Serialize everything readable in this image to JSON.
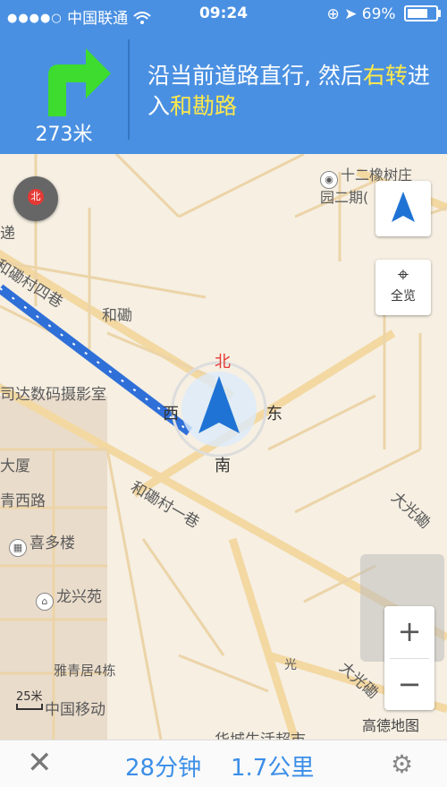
{
  "status_bar": {
    "signal_dots": "●●●●○",
    "carrier": "中国联通",
    "time": "09:24",
    "battery": "69%"
  },
  "guidance": {
    "distance": "273米",
    "instruction_part1": "沿当前道路直行, 然后",
    "instruction_turn": "右转",
    "instruction_part2": "进入",
    "instruction_road": "和勘路"
  },
  "map_labels": {
    "poi_top_right": "十二橡树庄园二期(",
    "road_hechi4": "和磡村四巷",
    "area_hechi": "和磡",
    "studio": "司达数码摄影室",
    "road_hechi1": "和磡村一巷",
    "dasha": "大厦",
    "road_west": "青西路",
    "xiduolou": "喜多楼",
    "longxingyuan": "龙兴苑",
    "yaqingju": "雅青居4栋",
    "china_mobile": "中国移动",
    "supermarket": "华城生活超市",
    "daguang_top": "大光磡",
    "daguang_bottom": "大光磡",
    "edge_ti": "递",
    "bus_stop": "光",
    "overview_label": "全览",
    "brand": "高德地图",
    "scale": "25米",
    "compass_mini_n": "北",
    "compass_n": "北",
    "compass_e": "东",
    "compass_s": "南",
    "compass_w": "西"
  },
  "bottom_bar": {
    "time_remaining": "28分钟",
    "distance_remaining": "1.7公里"
  },
  "colors": {
    "header_blue": "#4a90e2",
    "turn_green": "#3ddc2f",
    "highlight_yellow": "#ffe94a",
    "route_blue": "#2f6fd8"
  },
  "icons": [
    "turn-right-arrow-icon",
    "wifi-icon",
    "location-arrow-icon",
    "close-icon",
    "settings-gear-icon",
    "overview-icon",
    "car-arrow-icon"
  ]
}
